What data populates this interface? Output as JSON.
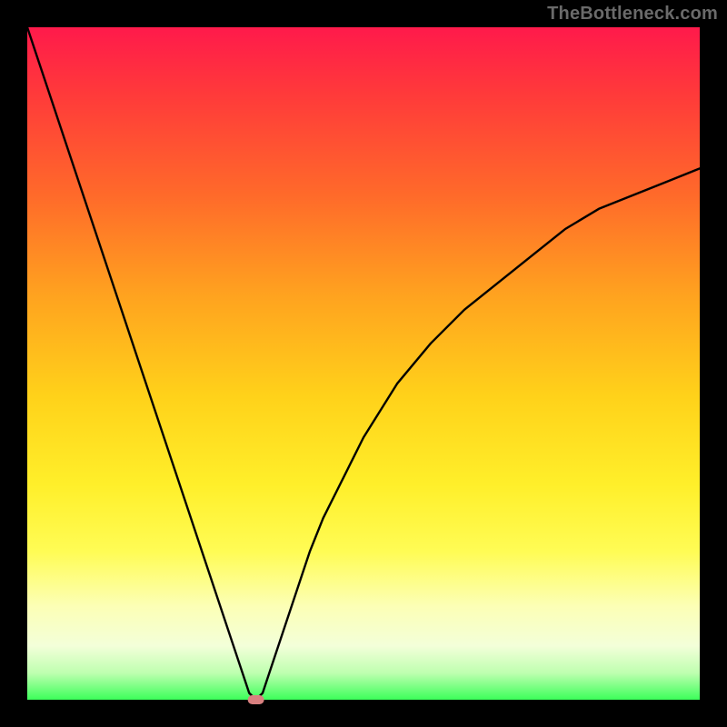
{
  "attribution": "TheBottleneck.com",
  "chart_data": {
    "type": "line",
    "title": "",
    "xlabel": "",
    "ylabel": "",
    "xlim": [
      0,
      100
    ],
    "ylim": [
      0,
      100
    ],
    "x": [
      0,
      2,
      4,
      6,
      8,
      10,
      12,
      14,
      16,
      18,
      20,
      22,
      24,
      26,
      28,
      30,
      32,
      33,
      34,
      35,
      36,
      38,
      40,
      42,
      44,
      46,
      48,
      50,
      55,
      60,
      65,
      70,
      75,
      80,
      85,
      90,
      95,
      100
    ],
    "values": [
      100,
      94,
      88,
      82,
      76,
      70,
      64,
      58,
      52,
      46,
      40,
      34,
      28,
      22,
      16,
      10,
      4,
      1,
      0,
      1,
      4,
      10,
      16,
      22,
      27,
      31,
      35,
      39,
      47,
      53,
      58,
      62,
      66,
      70,
      73,
      75,
      77,
      79
    ],
    "marker": {
      "x": 34,
      "y": 0,
      "color": "#d98080",
      "shape": "capsule"
    },
    "background": "vertical-gradient-red-to-green"
  }
}
